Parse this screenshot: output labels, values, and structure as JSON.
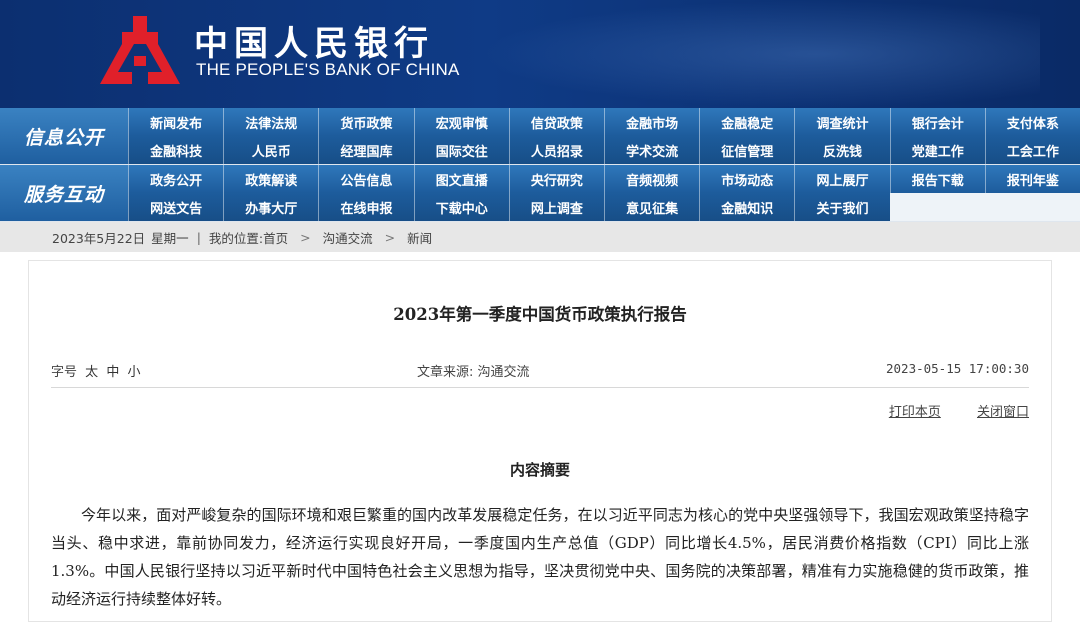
{
  "header": {
    "bank_name_cn": "中国人民银行",
    "bank_name_en": "THE PEOPLE'S BANK OF CHINA",
    "logo_icon": "pboc-emblem-icon",
    "colors": {
      "banner": "#0f3b86",
      "logo_red": "#e0202a",
      "nav": "#1f5fa0"
    }
  },
  "nav": {
    "info": {
      "label": "信息公开",
      "row1": [
        "新闻发布",
        "法律法规",
        "货币政策",
        "宏观审慎",
        "信贷政策",
        "金融市场",
        "金融稳定",
        "调查统计",
        "银行会计",
        "支付体系"
      ],
      "row2": [
        "金融科技",
        "人民币",
        "经理国库",
        "国际交往",
        "人员招录",
        "学术交流",
        "征信管理",
        "反洗钱",
        "党建工作",
        "工会工作"
      ]
    },
    "service": {
      "label": "服务互动",
      "row1": [
        "政务公开",
        "政策解读",
        "公告信息",
        "图文直播",
        "央行研究",
        "音频视频",
        "市场动态",
        "网上展厅",
        "报告下载",
        "报刊年鉴"
      ],
      "row2": [
        "网送文告",
        "办事大厅",
        "在线申报",
        "下载中心",
        "网上调查",
        "意见征集",
        "金融知识",
        "关于我们"
      ]
    }
  },
  "breadcrumb": {
    "date": "2023年5月22日",
    "weekday": "星期一",
    "location_prefix": "我的位置:",
    "home": "首页",
    "level1": "沟通交流",
    "level2": "新闻"
  },
  "article": {
    "title": "2023年第一季度中国货币政策执行报告",
    "font_size_label": "字号",
    "font_sizes": [
      "太",
      "中",
      "小"
    ],
    "source": "文章来源: 沟通交流",
    "timestamp": "2023-05-15 17:00:30",
    "print_label": "打印本页",
    "close_label": "关闭窗口",
    "section_heading": "内容摘要",
    "paragraph": "今年以来，面对严峻复杂的国际环境和艰巨繁重的国内改革发展稳定任务，在以习近平同志为核心的党中央坚强领导下，我国宏观政策坚持稳字当头、稳中求进，靠前协同发力，经济运行实现良好开局，一季度国内生产总值（GDP）同比增长4.5%，居民消费价格指数（CPI）同比上涨1.3%。中国人民银行坚持以习近平新时代中国特色社会主义思想为指导，坚决贯彻党中央、国务院的决策部署，精准有力实施稳健的货币政策，推动经济运行持续整体好转。"
  }
}
